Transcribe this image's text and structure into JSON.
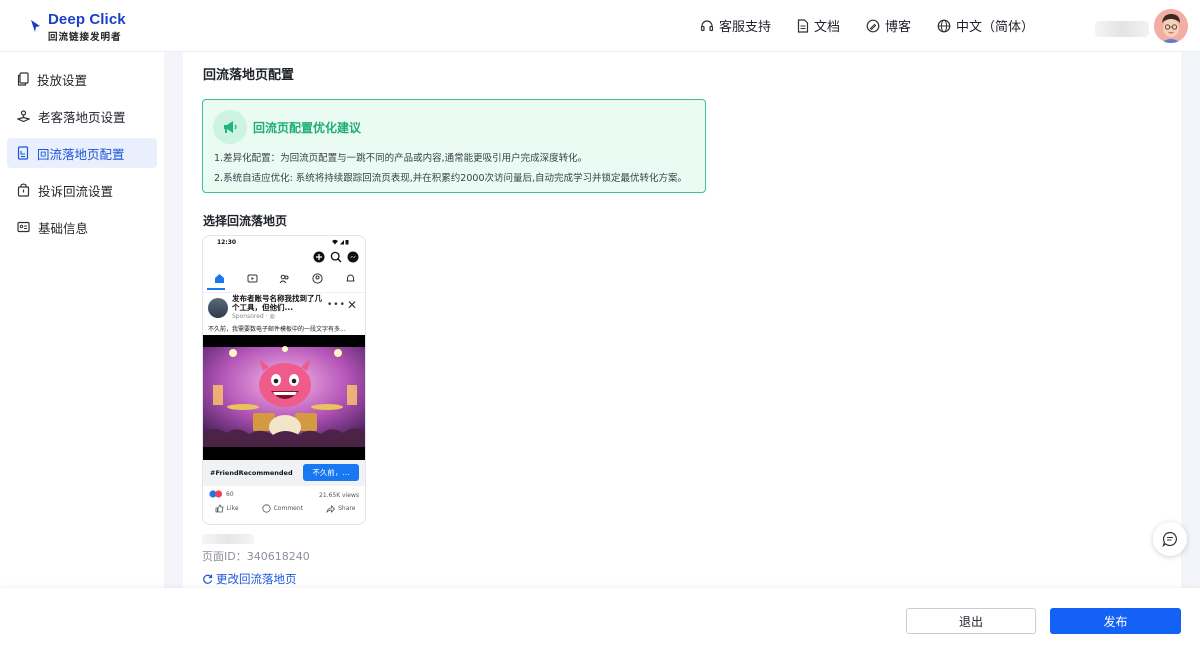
{
  "header": {
    "logo_title": "Deep Click",
    "logo_subtitle": "回流链接发明者",
    "nav": [
      {
        "label": "客服支持",
        "icon": "headset-icon"
      },
      {
        "label": "文档",
        "icon": "document-icon"
      },
      {
        "label": "博客",
        "icon": "blog-icon"
      },
      {
        "label": "中文（简体）",
        "icon": "globe-icon"
      }
    ]
  },
  "sidebar": {
    "items": [
      {
        "label": "投放设置",
        "icon": "copy-icon"
      },
      {
        "label": "老客落地页设置",
        "icon": "joystick-icon"
      },
      {
        "label": "回流落地页配置",
        "icon": "page-config-icon",
        "active": true
      },
      {
        "label": "投诉回流设置",
        "icon": "complaint-icon"
      },
      {
        "label": "基础信息",
        "icon": "id-card-icon"
      }
    ]
  },
  "main": {
    "title": "回流落地页配置",
    "tip": {
      "title": "回流页配置优化建议",
      "line1": "1.差异化配置：为回流页配置与一跳不同的产品或内容,通常能更吸引用户完成深度转化。",
      "line2": "2.系统自适应优化: 系统将持续跟踪回流页表现,并在积累约2000次访问量后,自动完成学习并锁定最优转化方案。"
    },
    "select_label": "选择回流落地页",
    "preview": {
      "time": "12:30",
      "post_title": "发布者账号名称我找到了几个工具，但他们...",
      "sponsored": "Sponsored · ◍",
      "post_text": "不久前，我需要数电子邮件模板中的一段文字有多...",
      "hashtag": "#FriendRecommended",
      "cta": "不久前，...",
      "reactions": "60",
      "views": "21.65K views",
      "like": "Like",
      "comment": "Comment",
      "share": "Share"
    },
    "page_id": "页面ID：340618240",
    "change_link": "更改回流落地页"
  },
  "footer": {
    "exit": "退出",
    "publish": "发布"
  },
  "colors": {
    "primary": "#1462f5",
    "tip_bg": "#e9fbf3",
    "tip_border": "#3dc48d",
    "tip_title": "#1fae74"
  }
}
